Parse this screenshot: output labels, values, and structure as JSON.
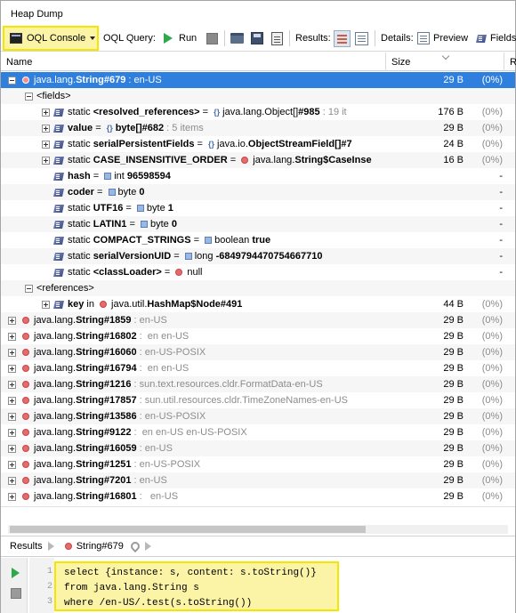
{
  "window": {
    "title": "Heap Dump"
  },
  "toolbar": {
    "oql_console": "OQL Console",
    "oql_query_label": "OQL Query:",
    "run": "Run",
    "results_label": "Results:",
    "details_label": "Details:",
    "preview": "Preview",
    "fields": "Fields"
  },
  "columns": {
    "name": "Name",
    "size": "Size",
    "retained": "R"
  },
  "rows": [
    {
      "class": "java.lang.",
      "cls_b": "String#679",
      "rest": " : en-US",
      "size": "29 B",
      "pct": "(0%)"
    },
    {
      "label": "<fields>"
    },
    {
      "pre": "static ",
      "b": "<resolved_references>",
      "mid": " = ",
      "t": "java.lang.Object[]",
      "tb": "#985",
      "gray": " : 19 it",
      "size": "176 B",
      "pct": "(0%)"
    },
    {
      "pre": "",
      "b": "value",
      "mid": " = ",
      "t": "",
      "tb": "byte[]#682",
      "gray": " : 5 items",
      "size": "29 B",
      "pct": "(0%)"
    },
    {
      "pre": "static ",
      "b": "serialPersistentFields",
      "mid": " = ",
      "t": "java.io.",
      "tb": "ObjectStreamField[]#7",
      "gray": "",
      "size": "24 B",
      "pct": "(0%)"
    },
    {
      "pre": "static ",
      "b": "CASE_INSENSITIVE_ORDER",
      "mid": " = ",
      "t": "java.lang.",
      "tb": "String$CaseInse",
      "gray": "",
      "size": "16 B",
      "pct": "(0%)"
    },
    {
      "pre": "",
      "b": "hash",
      "mid": " = ",
      "t": "int ",
      "tb": "96598594",
      "dash": "-"
    },
    {
      "pre": "",
      "b": "coder",
      "mid": " = ",
      "t": "byte ",
      "tb": "0",
      "dash": "-"
    },
    {
      "pre": "static ",
      "b": "UTF16",
      "mid": " = ",
      "t": "byte ",
      "tb": "1",
      "dash": "-"
    },
    {
      "pre": "static ",
      "b": "LATIN1",
      "mid": " = ",
      "t": "byte ",
      "tb": "0",
      "dash": "-"
    },
    {
      "pre": "static ",
      "b": "COMPACT_STRINGS",
      "mid": " = ",
      "t": "boolean ",
      "tb": "true",
      "dash": "-"
    },
    {
      "pre": "static ",
      "b": "serialVersionUID",
      "mid": " = ",
      "t": "long ",
      "tb": "-6849794470754667710",
      "dash": "-"
    },
    {
      "pre": "static ",
      "b": "<classLoader>",
      "mid": " = ",
      "t": "null",
      "tb": "",
      "dash": "-"
    },
    {
      "label": "<references>"
    },
    {
      "b": "key",
      "mid": " in ",
      "t": "java.util.",
      "tb": "HashMap$Node#491",
      "size": "44 B",
      "pct": "(0%)"
    },
    {
      "class": "java.lang.",
      "cls_b": "String#1859",
      "rest": " : en-US",
      "size": "29 B",
      "pct": "(0%)"
    },
    {
      "class": "java.lang.",
      "cls_b": "String#16802",
      "rest": " :  en en-US",
      "size": "29 B",
      "pct": "(0%)"
    },
    {
      "class": "java.lang.",
      "cls_b": "String#16060",
      "rest": " : en-US-POSIX",
      "size": "29 B",
      "pct": "(0%)"
    },
    {
      "class": "java.lang.",
      "cls_b": "String#16794",
      "rest": " :  en en-US",
      "size": "29 B",
      "pct": "(0%)"
    },
    {
      "class": "java.lang.",
      "cls_b": "String#1216",
      "rest": " : sun.text.resources.cldr.FormatData-en-US",
      "size": "29 B",
      "pct": "(0%)"
    },
    {
      "class": "java.lang.",
      "cls_b": "String#17857",
      "rest": " : sun.util.resources.cldr.TimeZoneNames-en-US",
      "size": "29 B",
      "pct": "(0%)"
    },
    {
      "class": "java.lang.",
      "cls_b": "String#13586",
      "rest": " : en-US-POSIX",
      "size": "29 B",
      "pct": "(0%)"
    },
    {
      "class": "java.lang.",
      "cls_b": "String#9122",
      "rest": " :  en en-US en-US-POSIX",
      "size": "29 B",
      "pct": "(0%)"
    },
    {
      "class": "java.lang.",
      "cls_b": "String#16059",
      "rest": " : en-US",
      "size": "29 B",
      "pct": "(0%)"
    },
    {
      "class": "java.lang.",
      "cls_b": "String#1251",
      "rest": " : en-US-POSIX",
      "size": "29 B",
      "pct": "(0%)"
    },
    {
      "class": "java.lang.",
      "cls_b": "String#7201",
      "rest": " : en-US",
      "size": "29 B",
      "pct": "(0%)"
    },
    {
      "class": "java.lang.",
      "cls_b": "String#16801",
      "rest": " :   en-US",
      "size": "29 B",
      "pct": "(0%)"
    }
  ],
  "breadcrumb": {
    "results": "Results",
    "item": "String#679"
  },
  "editor": {
    "line_numbers": [
      "1",
      "2",
      "3"
    ],
    "lines": [
      "select {instance: s, content: s.toString()}",
      "from java.lang.String s",
      "where /en-US/.test(s.toString())"
    ]
  },
  "colors": {
    "selection": "#2f7fde",
    "highlight_fill": "#fbf3a6",
    "highlight_border": "#f5e600",
    "instance_dot": "#e36c6c"
  }
}
